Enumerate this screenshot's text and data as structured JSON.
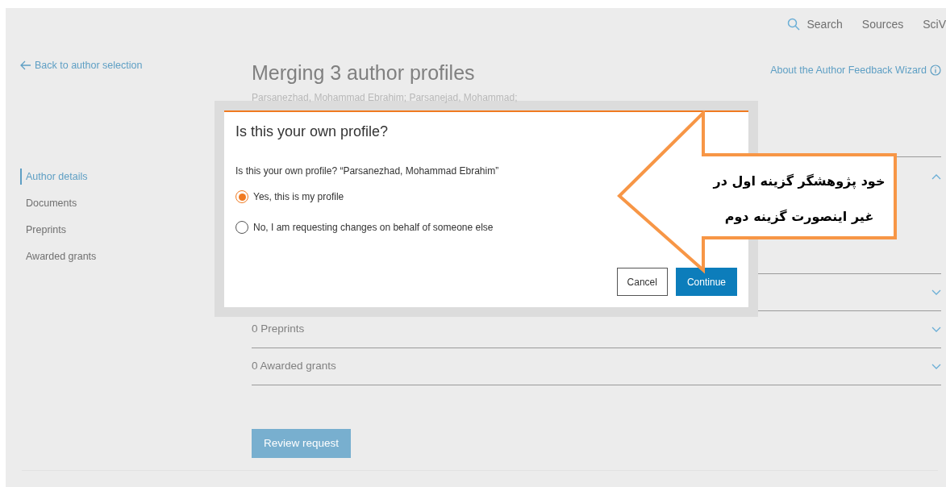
{
  "header": {
    "nav": [
      {
        "label": "Search",
        "kind": "search"
      },
      {
        "label": "Sources",
        "kind": "link"
      },
      {
        "label": "SciV",
        "kind": "link"
      }
    ]
  },
  "back_link": "Back to author selection",
  "sidebar": {
    "items": [
      {
        "label": "Author details",
        "selected": true
      },
      {
        "label": "Documents",
        "selected": false
      },
      {
        "label": "Preprints",
        "selected": false
      },
      {
        "label": "Awarded grants",
        "selected": false
      }
    ]
  },
  "title": "Merging 3 author profiles",
  "subtitle": "Parsanezhad, Mohammad Ebrahim; Parsanejad, Mohammad;",
  "help_link": "About the Author Feedback Wizard",
  "sections": [
    {
      "expanded": true
    },
    {
      "expanded": false
    },
    {
      "label": "0 Preprints",
      "expanded": false
    },
    {
      "label": "0 Awarded grants",
      "expanded": false
    }
  ],
  "review_button": {
    "label": "Review request",
    "disabled": true
  },
  "dialog": {
    "title": "Is this your own profile?",
    "question": "Is this your own profile? “Parsanezhad, Mohammad Ebrahim”",
    "options": [
      {
        "label": "Yes, this is my profile",
        "selected": true
      },
      {
        "label": "No, I am requesting changes on behalf of someone else",
        "selected": false
      }
    ],
    "buttons": [
      {
        "label": "Cancel",
        "kind": "secondary"
      },
      {
        "label": "Continue",
        "kind": "primary"
      }
    ]
  },
  "callout": {
    "lines": [
      "خود پژوهشگر گزینه اول در",
      "غیر اینصورت گزینه دوم"
    ]
  }
}
